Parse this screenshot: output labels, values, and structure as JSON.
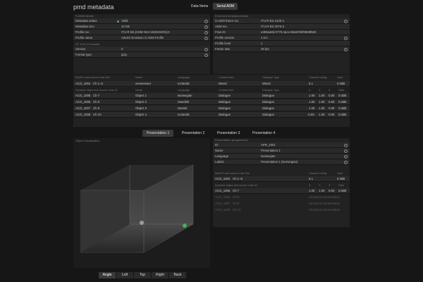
{
  "app": {
    "title": "pmd metadata"
  },
  "top_tabs": [
    {
      "label": "Data Items",
      "selected": false
    },
    {
      "label": "Serial ADM",
      "selected": true
    }
  ],
  "left": {
    "section_adm": "S-ADM stream",
    "rows": [
      {
        "label": "Metadata status",
        "value": "Valid",
        "status_color": "#4caf50"
      },
      {
        "label": "Metadata size",
        "value": "10 KB"
      },
      {
        "label": "Profile rec.",
        "value": "ITU-R BS.[ADM-NGA-EMISSION]-0"
      },
      {
        "label": "Profile name",
        "value": "AdvSS Emission S-ADM Profile"
      }
    ],
    "section_header": "ST 2121-10 header",
    "rows2": [
      {
        "label": "Version",
        "value": "0"
      },
      {
        "label": "Format type",
        "value": "gzip"
      }
    ]
  },
  "right": {
    "section": "Extended metadata details",
    "rows": [
      {
        "label": "S-ADM frame rec.",
        "value": "ITU-R BS.2125-1"
      },
      {
        "label": "ADM rec.",
        "value": "ITU-R BS.2076-3"
      },
      {
        "label": "Flow ID",
        "value": "e369aa65-0775-4ace-85a8-f50f0868f8d3"
      },
      {
        "label": "Profile version",
        "value": "1.0.0"
      },
      {
        "label": "Profile level",
        "value": "1"
      },
      {
        "label": "Frame rate",
        "value": "25 fps"
      }
    ]
  },
  "bed": {
    "headers": [
      "Bed/Ch and source chan IDs",
      "Name",
      "Language",
      "Content kind",
      "Dialogue Type",
      "Channel config",
      "Gain"
    ],
    "row": {
      "id": "ACO_1004",
      "ch": "Ch 1–6",
      "name": "verweerwer",
      "lang": "Icelandic",
      "kind": "Mixed",
      "dtype": "Mixed",
      "cfg": "5.1",
      "gain": "0.0dB"
    }
  },
  "objects": {
    "headers": [
      "Dynamic object and source chan ID",
      "Name",
      "Language",
      "Content kind",
      "Dialogue Type",
      "X",
      "Y",
      "Z",
      "Gain"
    ],
    "rows": [
      {
        "id": "ACO_1005",
        "ch": "Ch 7",
        "name": "Object 1",
        "lang": "Norwegian",
        "kind": "Dialogue",
        "dtype": "Dialogue",
        "x": "1.00",
        "y": "1.00",
        "z": "0.00",
        "gain": "0.0dB"
      },
      {
        "id": "ACO_1006",
        "ch": "Ch 8",
        "name": "Object 2",
        "lang": "Swedish",
        "kind": "Dialogue",
        "dtype": "Dialogue",
        "x": "1.00",
        "y": "1.00",
        "z": "0.00",
        "gain": "0.0dB"
      },
      {
        "id": "ACO_1007",
        "ch": "Ch 9",
        "name": "Object 3",
        "lang": "Danish",
        "kind": "Dialogue",
        "dtype": "Dialogue",
        "x": "1.00",
        "y": "1.00",
        "z": "0.00",
        "gain": "0.0dB"
      },
      {
        "id": "ACO_1008",
        "ch": "Ch 10",
        "name": "Object 4",
        "lang": "Icelandic",
        "kind": "Dialogue",
        "dtype": "Dialogue",
        "x": "-0.50",
        "y": "1.00",
        "z": "0.00",
        "gain": "0.0dB"
      }
    ]
  },
  "presentation_tabs": [
    {
      "label": "Presentation 1",
      "selected": true
    },
    {
      "label": "Presentation 2"
    },
    {
      "label": "Presentation 3"
    },
    {
      "label": "Presentation 4"
    }
  ],
  "viz": {
    "title": "Object visualization",
    "view_buttons": [
      {
        "label": "Angle",
        "selected": true
      },
      {
        "label": "Left"
      },
      {
        "label": "Top"
      },
      {
        "label": "Right"
      },
      {
        "label": "Back"
      }
    ]
  },
  "pres": {
    "title": "Presentation (programme)",
    "rows": [
      {
        "label": "ID",
        "value": "APR_1001"
      },
      {
        "label": "Name",
        "value": "Presentation 1"
      },
      {
        "label": "Language",
        "value": "Norwegian"
      },
      {
        "label": "Labels",
        "value": "Presentation 1 (Norwegian)"
      }
    ],
    "bed_headers": [
      "Bed/Ch and source chan IDs",
      "Channel config",
      "Gain"
    ],
    "bed_row": {
      "id": "ACO_1004",
      "ch": "Ch 1–6",
      "cfg": "5.1",
      "gain": "0.0dB"
    },
    "obj_headers": [
      "Dynamic object and source chan ID",
      "X",
      "Y",
      "Z",
      "Gain"
    ],
    "obj_rows": [
      {
        "id": "ACO_1005",
        "ch": "Ch 7",
        "x": "1.00",
        "y": "1.00",
        "z": "0.00",
        "gain": "0.0dB",
        "active": true
      },
      {
        "id": "ACO_1006",
        "ch": "Ch 8",
        "note": "Unused in presentation",
        "active": false
      },
      {
        "id": "ACO_1007",
        "ch": "Ch 9",
        "note": "Unused in presentation",
        "active": false
      },
      {
        "id": "ACO_1008",
        "ch": "Ch 10",
        "note": "Unused in presentation",
        "active": false
      }
    ]
  }
}
